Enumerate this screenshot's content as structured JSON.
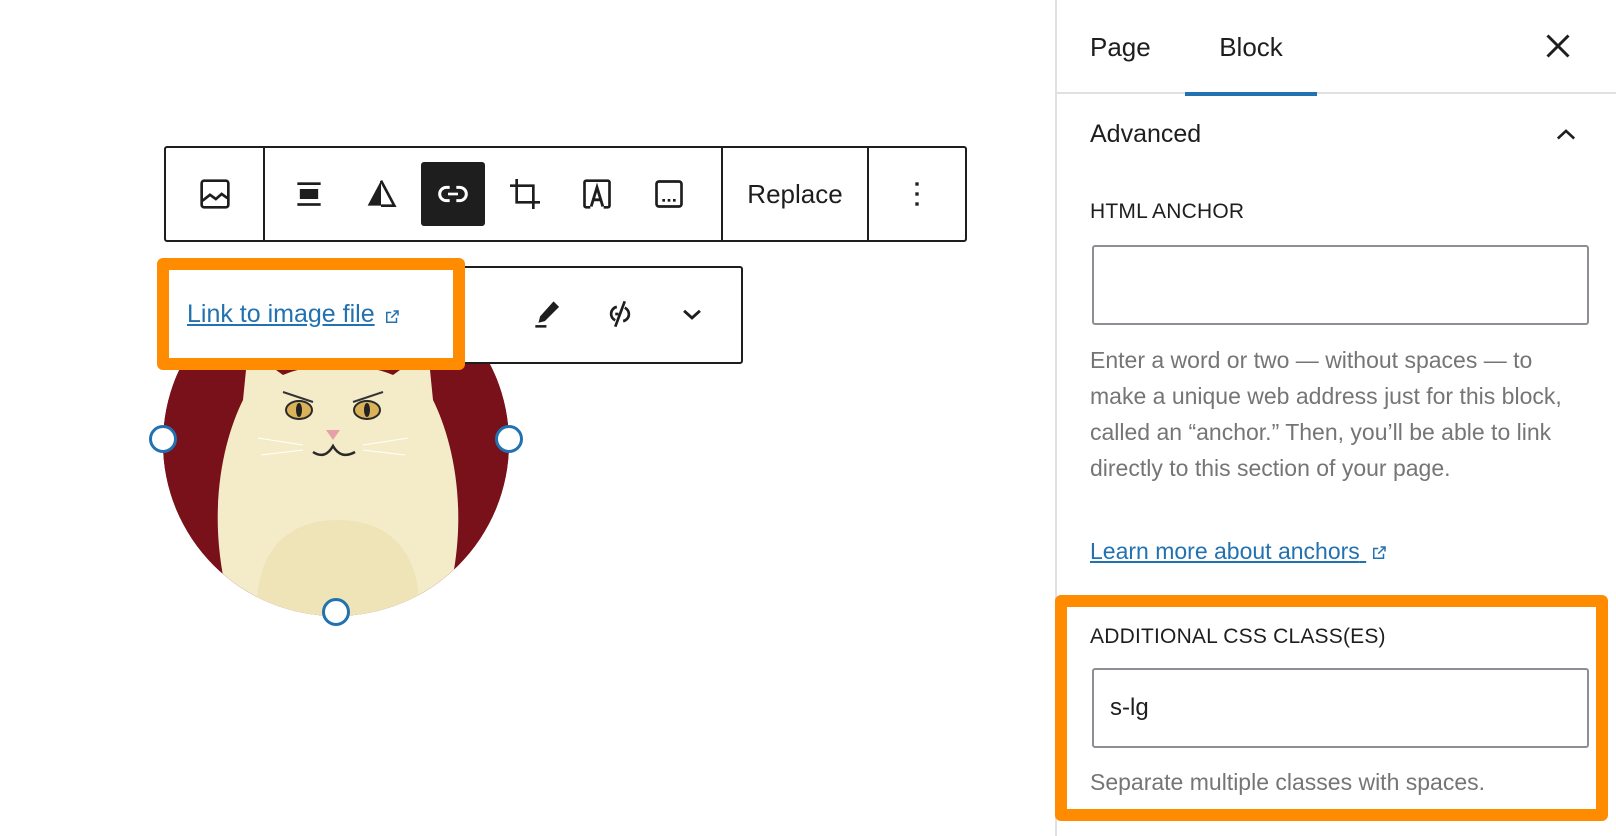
{
  "block_toolbar": {
    "buttons": [
      {
        "name": "image-block-type",
        "icon": "image-icon"
      },
      {
        "name": "align",
        "icon": "align-full-icon"
      },
      {
        "name": "duotone",
        "icon": "duotone-filter-icon"
      },
      {
        "name": "link",
        "icon": "link-icon",
        "active": true
      },
      {
        "name": "crop",
        "icon": "crop-icon"
      },
      {
        "name": "text-overlay",
        "icon": "text-overlay-icon"
      },
      {
        "name": "caption",
        "icon": "caption-icon"
      }
    ],
    "replace_label": "Replace",
    "more_options_icon": "vertical-ellipsis-icon"
  },
  "link_popover": {
    "link_text": "Link to image file",
    "external_icon": "external-link-icon",
    "actions": [
      "edit-pencil-icon",
      "unlink-icon",
      "chevron-down-icon"
    ]
  },
  "image": {
    "description": "Illustration of a grumpy white cat on a dark red circular background",
    "background_color": "#78111a"
  },
  "sidebar": {
    "tabs": [
      {
        "label": "Page",
        "active": false
      },
      {
        "label": "Block",
        "active": true
      }
    ],
    "close_icon": "close-icon",
    "panel": {
      "title": "Advanced",
      "expanded": true,
      "html_anchor": {
        "label": "HTML ANCHOR",
        "value": "",
        "help": "Enter a word or two — without spaces — to make a unique web address just for this block, called an “anchor.” Then, you’ll be able to link directly to this section of your page.",
        "learn_more": "Learn more about anchors"
      },
      "css_classes": {
        "label": "ADDITIONAL CSS CLASS(ES)",
        "value": "s-lg",
        "help": "Separate multiple classes with spaces."
      }
    }
  },
  "colors": {
    "accent": "#2271b1",
    "highlight": "#ff8c00",
    "text": "#1e1e1e",
    "muted": "#757575"
  }
}
